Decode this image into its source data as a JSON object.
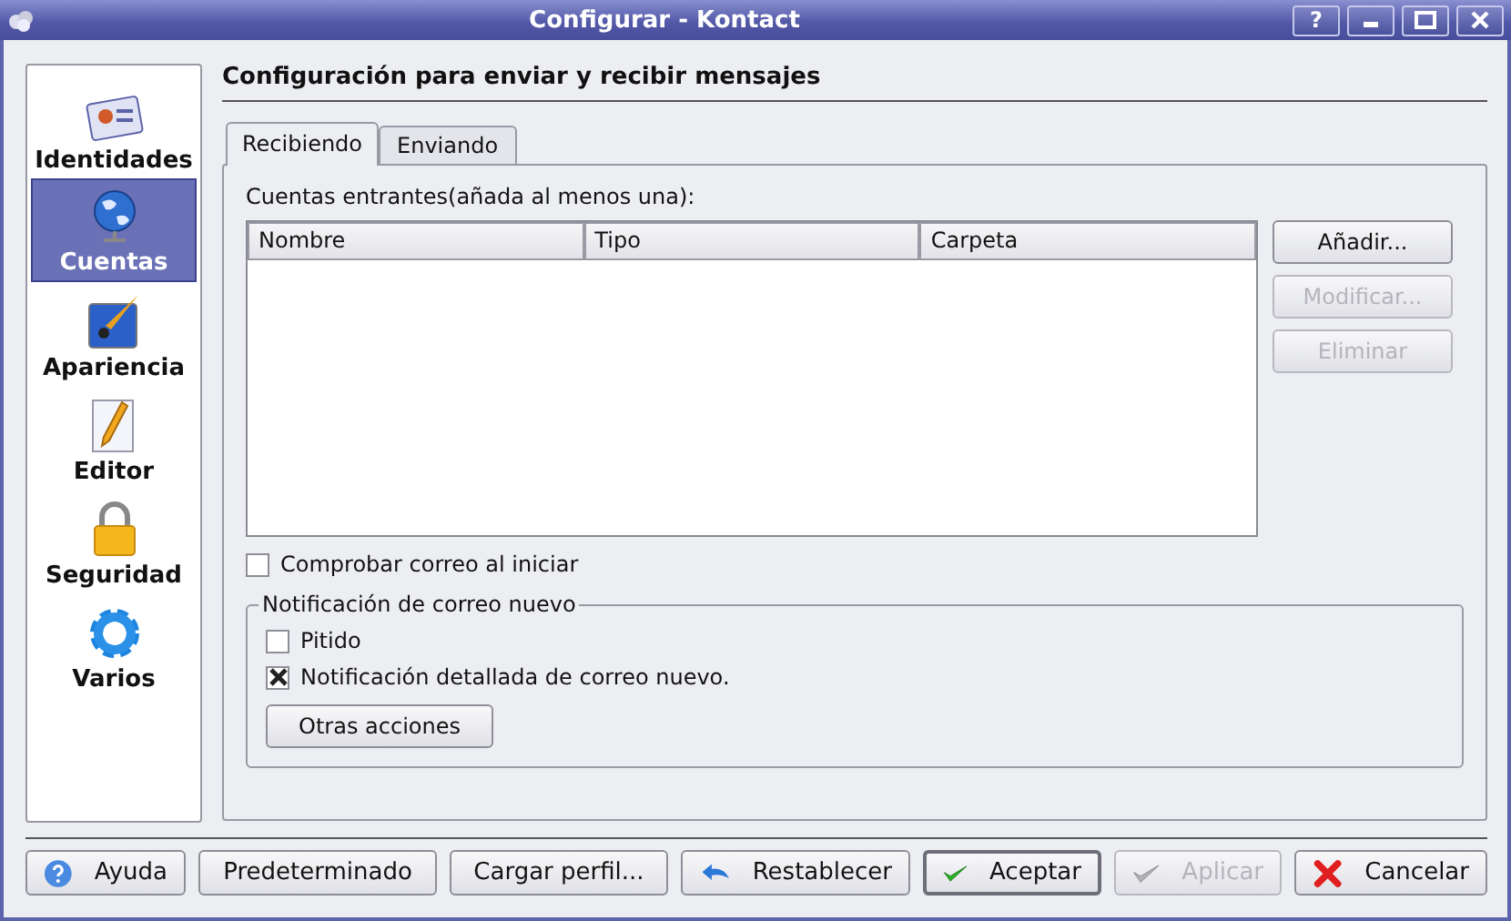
{
  "window": {
    "title": "Configurar - Kontact",
    "controls": [
      "?"
    ]
  },
  "sidebar": {
    "items": [
      {
        "label": "Identidades",
        "selected": false
      },
      {
        "label": "Cuentas",
        "selected": true
      },
      {
        "label": "Apariencia",
        "selected": false
      },
      {
        "label": "Editor",
        "selected": false
      },
      {
        "label": "Seguridad",
        "selected": false
      },
      {
        "label": "Varios",
        "selected": false
      }
    ]
  },
  "heading": "Configuración para enviar y recibir mensajes",
  "tabs": [
    {
      "label": "Recibiendo",
      "selected": true
    },
    {
      "label": "Enviando",
      "selected": false
    }
  ],
  "accounts_label": "Cuentas entrantes(añada al menos una):",
  "table": {
    "columns": [
      "Nombre",
      "Tipo",
      "Carpeta"
    ]
  },
  "side_buttons": [
    {
      "label": "Añadir...",
      "disabled": false
    },
    {
      "label": "Modificar...",
      "disabled": true
    },
    {
      "label": "Eliminar",
      "disabled": true
    }
  ],
  "check_on_start": {
    "label": "Comprobar correo al iniciar",
    "checked": false
  },
  "notification": {
    "title": "Notificación de correo nuevo",
    "options": [
      {
        "label": "Pitido",
        "checked": false
      },
      {
        "label": "Notificación detallada de correo nuevo.",
        "checked": true
      }
    ],
    "button": "Otras acciones"
  },
  "buttons": [
    {
      "label": "Ayuda",
      "disabled": false,
      "default": false
    },
    {
      "label": "Predeterminado",
      "disabled": false,
      "default": false
    },
    {
      "label": "Cargar perfil...",
      "disabled": false,
      "default": false
    },
    {
      "label": "Restablecer",
      "disabled": false,
      "default": false
    },
    {
      "label": "Aceptar",
      "disabled": false,
      "default": true
    },
    {
      "label": "Aplicar",
      "disabled": true,
      "default": false
    },
    {
      "label": "Cancelar",
      "disabled": false,
      "default": false
    }
  ]
}
